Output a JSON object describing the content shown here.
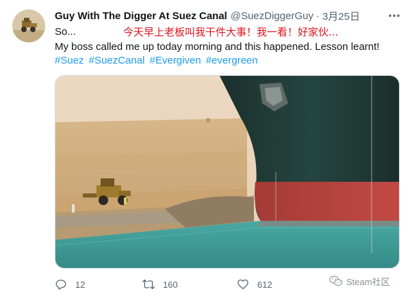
{
  "tweet": {
    "display_name": "Guy With The Digger At Suez Canal",
    "handle": "@SuezDiggerGuy",
    "dot": "·",
    "date": "3月25日",
    "text_prefix": "So...",
    "annotation_cn": "今天早上老板叫我干件大事！我一看！好家伙...",
    "text_line2": "My boss called me up today morning and this happened. Lesson learnt!",
    "hashtags": [
      "#Suez",
      "#SuezCanal",
      "#Evergiven",
      "#evergreen"
    ]
  },
  "actions": {
    "reply_count": "12",
    "retweet_count": "160",
    "like_count": "612"
  },
  "watermark": {
    "text": "Steam社区"
  },
  "icons": {
    "more": "more-icon",
    "reply": "reply-icon",
    "retweet": "retweet-icon",
    "like": "heart-icon",
    "watermark": "wechat-icon"
  },
  "colors": {
    "hashtag": "#1d9bf0",
    "annotation": "#e0141e",
    "secondary_text": "#536471",
    "ship_hull_dark": "#1f3a35",
    "ship_hull_red": "#b5403c",
    "water": "#3f9c97"
  }
}
